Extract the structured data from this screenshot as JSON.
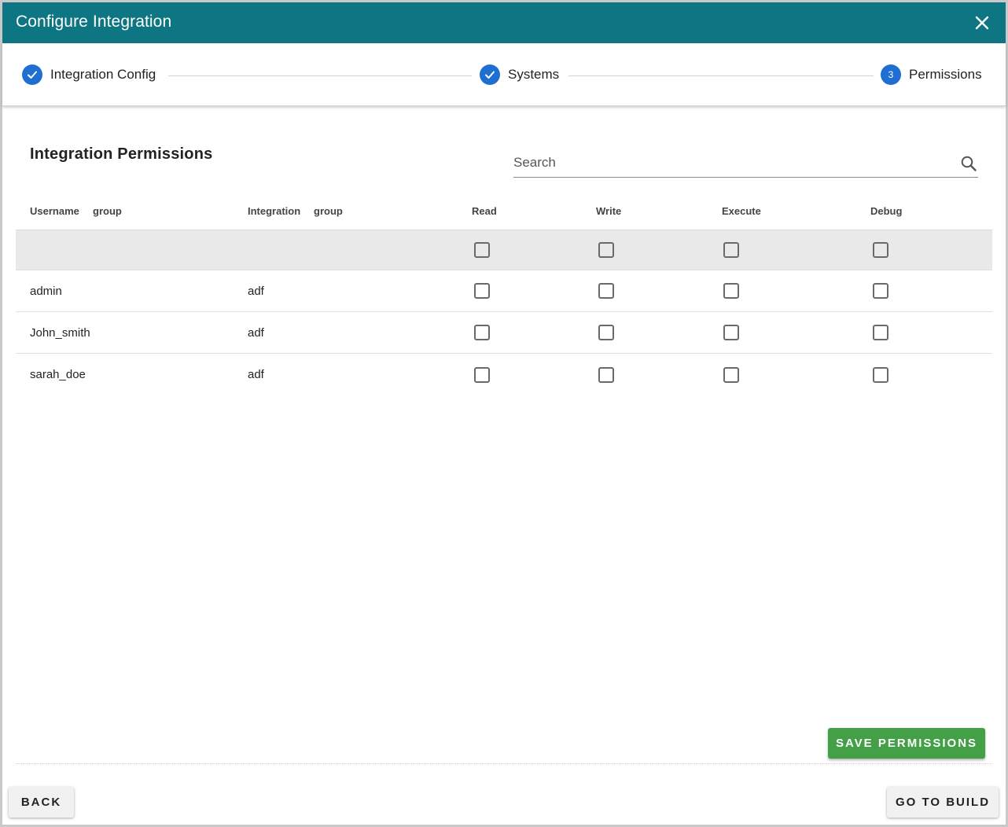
{
  "dialog": {
    "title": "Configure Integration"
  },
  "stepper": {
    "steps": [
      {
        "label": "Integration Config",
        "status": "complete"
      },
      {
        "label": "Systems",
        "status": "complete"
      },
      {
        "label": "Permissions",
        "status": "active",
        "number": "3"
      }
    ]
  },
  "permissions": {
    "heading": "Integration Permissions",
    "search": {
      "placeholder": "Search",
      "value": ""
    },
    "columns": {
      "username": "Username",
      "username_group": "group",
      "integration": "Integration",
      "integration_group": "group",
      "read": "Read",
      "write": "Write",
      "execute": "Execute",
      "debug": "Debug"
    },
    "rows": [
      {
        "username": "admin",
        "integration": "adf",
        "read": false,
        "write": false,
        "execute": false,
        "debug": false
      },
      {
        "username": "John_smith",
        "integration": "adf",
        "read": false,
        "write": false,
        "execute": false,
        "debug": false
      },
      {
        "username": "sarah_doe",
        "integration": "adf",
        "read": false,
        "write": false,
        "execute": false,
        "debug": false
      }
    ]
  },
  "buttons": {
    "save": "SAVE PERMISSIONS",
    "back": "BACK",
    "go_to_build": "GO TO BUILD"
  },
  "colors": {
    "header": "#0e7582",
    "step_circle": "#1e6fd1",
    "save_button": "#43a047"
  },
  "icons": {
    "close": "close-icon",
    "check": "check-icon",
    "search": "search-icon"
  }
}
